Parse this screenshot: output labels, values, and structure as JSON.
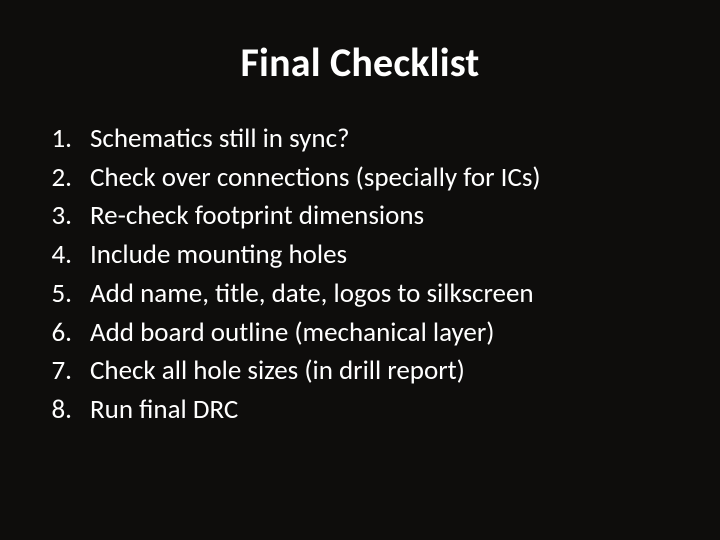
{
  "title": "Final Checklist",
  "items": [
    {
      "num": "1.",
      "text": "Schematics still in sync?"
    },
    {
      "num": "2.",
      "text": "Check over connections (specially for ICs)"
    },
    {
      "num": "3.",
      "text": "Re-check footprint dimensions"
    },
    {
      "num": "4.",
      "text": "Include mounting holes"
    },
    {
      "num": "5.",
      "text": "Add name, title, date, logos to silkscreen"
    },
    {
      "num": "6.",
      "text": "Add board outline (mechanical layer)"
    },
    {
      "num": "7.",
      "text": "Check all hole sizes (in drill report)"
    },
    {
      "num": "8.",
      "text": "Run final DRC"
    }
  ]
}
